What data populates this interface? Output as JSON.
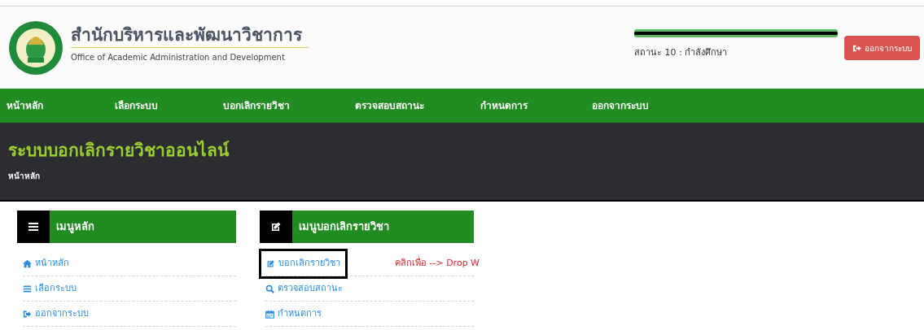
{
  "header": {
    "title": "สำนักบริหารและพัฒนาวิชาการ",
    "subtitle": "Office of Academic Administration and Development",
    "user_redacted": true,
    "status": "สถานะ 10 : กำลังศึกษา",
    "logout_button": "ออกจากระบบ"
  },
  "nav": [
    "หน้าหลัก",
    "เลือกระบบ",
    "บอกเลิกรายวิชา",
    "ตรวจสอบสถานะ",
    "กำหนดการ",
    "ออกจากระบบ"
  ],
  "banner": {
    "title": "ระบบบอกเลิกรายวิชาออนไลน์",
    "breadcrumb": "หน้าหลัก"
  },
  "panels": [
    {
      "title": "เมนูหลัก",
      "kind": "menu",
      "items": [
        {
          "label": "หน้าหลัก",
          "kind": "home",
          "highlighted": false
        },
        {
          "label": "เลือกระบบ",
          "kind": "menu",
          "highlighted": false
        },
        {
          "label": "ออกจากระบบ",
          "kind": "signout",
          "highlighted": false
        }
      ]
    },
    {
      "title": "เมนูบอกเลิกรายวิชา",
      "kind": "edit",
      "items": [
        {
          "label": "บอกเลิกรายวิชา",
          "kind": "edit",
          "highlighted": true,
          "note": "คลิกเพื่อ --> Drop W"
        },
        {
          "label": "ตรวจสอบสถานะ",
          "kind": "search",
          "highlighted": false
        },
        {
          "label": "กำหนดการ",
          "kind": "calendar",
          "highlighted": false
        }
      ]
    }
  ]
}
